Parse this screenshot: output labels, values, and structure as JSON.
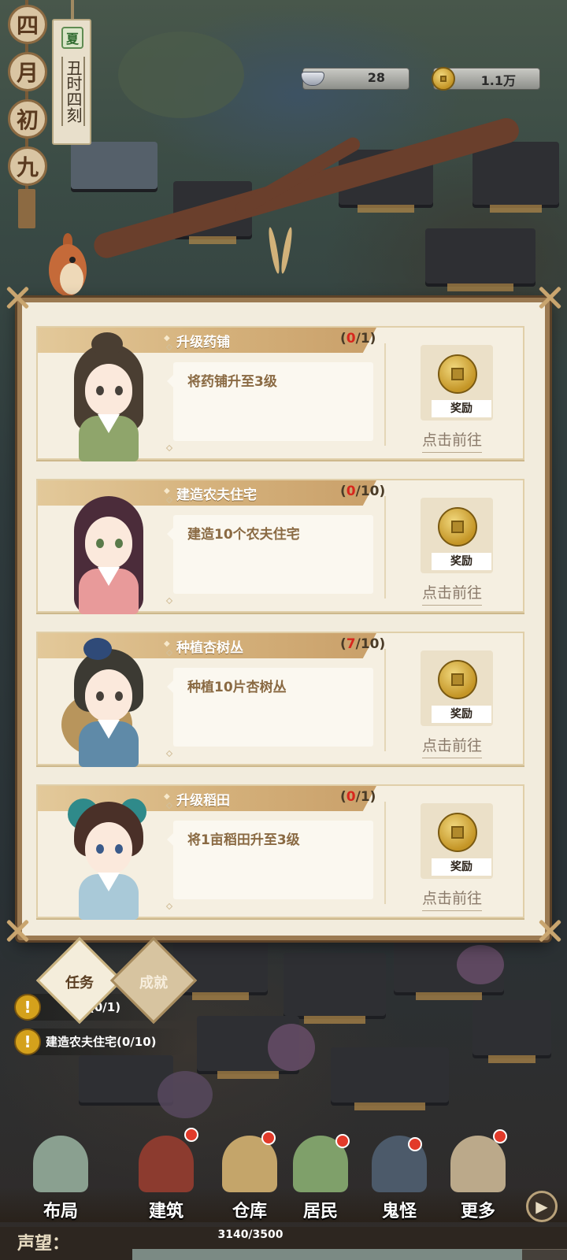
{
  "calendar": {
    "month_chars": [
      "四",
      "月",
      "初",
      "九"
    ],
    "season": "夏",
    "time": "丑时四刻"
  },
  "resources": {
    "ingot": {
      "icon": "silver-ingot-icon",
      "value": "28"
    },
    "coins": {
      "icon": "copper-coin-icon",
      "value": "1.1万"
    }
  },
  "tasks": [
    {
      "title": "升级药铺",
      "progress_current": "0",
      "progress_total": "/1",
      "description": "将药铺升至3级",
      "reward_label": "奖励",
      "go_label": "点击前往"
    },
    {
      "title": "建造农夫住宅",
      "progress_current": "0",
      "progress_total": "/10",
      "description": "建造10个农夫住宅",
      "reward_label": "奖励",
      "go_label": "点击前往"
    },
    {
      "title": "种植杏树丛",
      "progress_current": "7",
      "progress_total": "/10",
      "description": "种植10片杏树丛",
      "reward_label": "奖励",
      "go_label": "点击前往"
    },
    {
      "title": "升级稻田",
      "progress_current": "0",
      "progress_total": "/1",
      "description": "将1亩稻田升至3级",
      "reward_label": "奖励",
      "go_label": "点击前往"
    }
  ],
  "tracker": {
    "tabs": {
      "tasks": "任务",
      "achievements": "成就"
    },
    "items": [
      "铺(0/1)",
      "建造农夫住宅(0/10)"
    ]
  },
  "bottom_nav": [
    {
      "label": "布局",
      "badge": false
    },
    {
      "label": "建筑",
      "badge": true
    },
    {
      "label": "仓库",
      "badge": true
    },
    {
      "label": "居民",
      "badge": true
    },
    {
      "label": "鬼怪",
      "badge": true
    },
    {
      "label": "更多",
      "badge": true
    }
  ],
  "reputation": {
    "label": "声望：",
    "current": 3140,
    "max": 3500,
    "text": "3140/3500"
  },
  "colors": {
    "accent_gold": "#c9a06a",
    "progress_red": "#d8261d",
    "frame_brown": "#9b7a52"
  }
}
